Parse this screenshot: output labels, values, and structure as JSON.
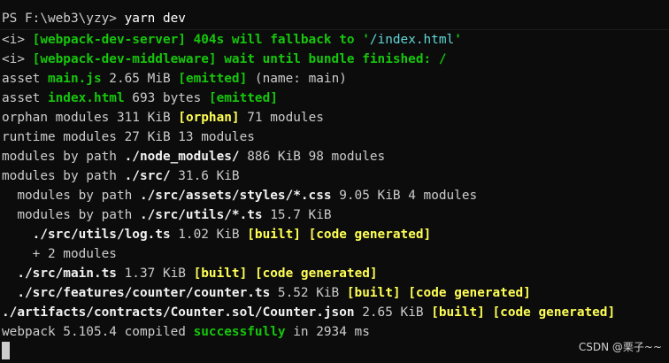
{
  "colors": {
    "background": "#0c0c0c",
    "default_text": "#cccccc",
    "green": "#16c60c",
    "yellow": "#ffff55",
    "cyan": "#61d6d6"
  },
  "prompt": {
    "path": "PS F:\\web3\\yzy>",
    "command": "yarn dev"
  },
  "lines": [
    [
      {
        "text": "<i> ",
        "style": "default"
      },
      {
        "text": "[webpack-dev-server] 404s will fallback to '",
        "style": "green"
      },
      {
        "text": "/index.html",
        "style": "cyan"
      },
      {
        "text": "'",
        "style": "green"
      }
    ],
    [
      {
        "text": "<i> ",
        "style": "default"
      },
      {
        "text": "[webpack-dev-middleware] wait until bundle finished: /",
        "style": "green"
      }
    ],
    [
      {
        "text": "asset ",
        "style": "default"
      },
      {
        "text": "main.js",
        "style": "green"
      },
      {
        "text": " 2.65 MiB ",
        "style": "default"
      },
      {
        "text": "[emitted]",
        "style": "green"
      },
      {
        "text": " (name: main)",
        "style": "default"
      }
    ],
    [
      {
        "text": "asset ",
        "style": "default"
      },
      {
        "text": "index.html",
        "style": "green"
      },
      {
        "text": " 693 bytes ",
        "style": "default"
      },
      {
        "text": "[emitted]",
        "style": "green"
      }
    ],
    [
      {
        "text": "orphan modules 311 KiB ",
        "style": "default"
      },
      {
        "text": "[orphan]",
        "style": "yellow"
      },
      {
        "text": " 71 modules",
        "style": "default"
      }
    ],
    [
      {
        "text": "runtime modules 27 KiB 13 modules",
        "style": "default"
      }
    ],
    [
      {
        "text": "modules by path ",
        "style": "default"
      },
      {
        "text": "./node_modules/",
        "style": "bold"
      },
      {
        "text": " 886 KiB 98 modules",
        "style": "default"
      }
    ],
    [
      {
        "text": "modules by path ",
        "style": "default"
      },
      {
        "text": "./src/",
        "style": "bold"
      },
      {
        "text": " 31.6 KiB",
        "style": "default"
      }
    ],
    [
      {
        "text": "  modules by path ",
        "style": "default"
      },
      {
        "text": "./src/assets/styles/*.css",
        "style": "bold"
      },
      {
        "text": " 9.05 KiB 4 modules",
        "style": "default"
      }
    ],
    [
      {
        "text": "  modules by path ",
        "style": "default"
      },
      {
        "text": "./src/utils/*.ts",
        "style": "bold"
      },
      {
        "text": " 15.7 KiB",
        "style": "default"
      }
    ],
    [
      {
        "text": "    ./src/utils/log.ts",
        "style": "bold"
      },
      {
        "text": " 1.02 KiB ",
        "style": "default"
      },
      {
        "text": "[built]",
        "style": "yellow"
      },
      {
        "text": " ",
        "style": "default"
      },
      {
        "text": "[code generated]",
        "style": "yellow"
      }
    ],
    [
      {
        "text": "    + 2 modules",
        "style": "default"
      }
    ],
    [
      {
        "text": "  ./src/main.ts",
        "style": "bold"
      },
      {
        "text": " 1.37 KiB ",
        "style": "default"
      },
      {
        "text": "[built]",
        "style": "yellow"
      },
      {
        "text": " ",
        "style": "default"
      },
      {
        "text": "[code generated]",
        "style": "yellow"
      }
    ],
    [
      {
        "text": "  ./src/features/counter/counter.ts",
        "style": "bold"
      },
      {
        "text": " 5.52 KiB ",
        "style": "default"
      },
      {
        "text": "[built]",
        "style": "yellow"
      },
      {
        "text": " ",
        "style": "default"
      },
      {
        "text": "[code generated]",
        "style": "yellow"
      }
    ],
    [
      {
        "text": "./artifacts/contracts/Counter.sol/Counter.json",
        "style": "bold"
      },
      {
        "text": " 2.65 KiB ",
        "style": "default"
      },
      {
        "text": "[built]",
        "style": "yellow"
      },
      {
        "text": " ",
        "style": "default"
      },
      {
        "text": "[code generated]",
        "style": "yellow"
      }
    ],
    [
      {
        "text": "webpack 5.105.4 compiled ",
        "style": "default"
      },
      {
        "text": "successfully",
        "style": "green"
      },
      {
        "text": " in 2934 ms",
        "style": "default"
      }
    ]
  ],
  "watermark": "CSDN @栗子~~"
}
